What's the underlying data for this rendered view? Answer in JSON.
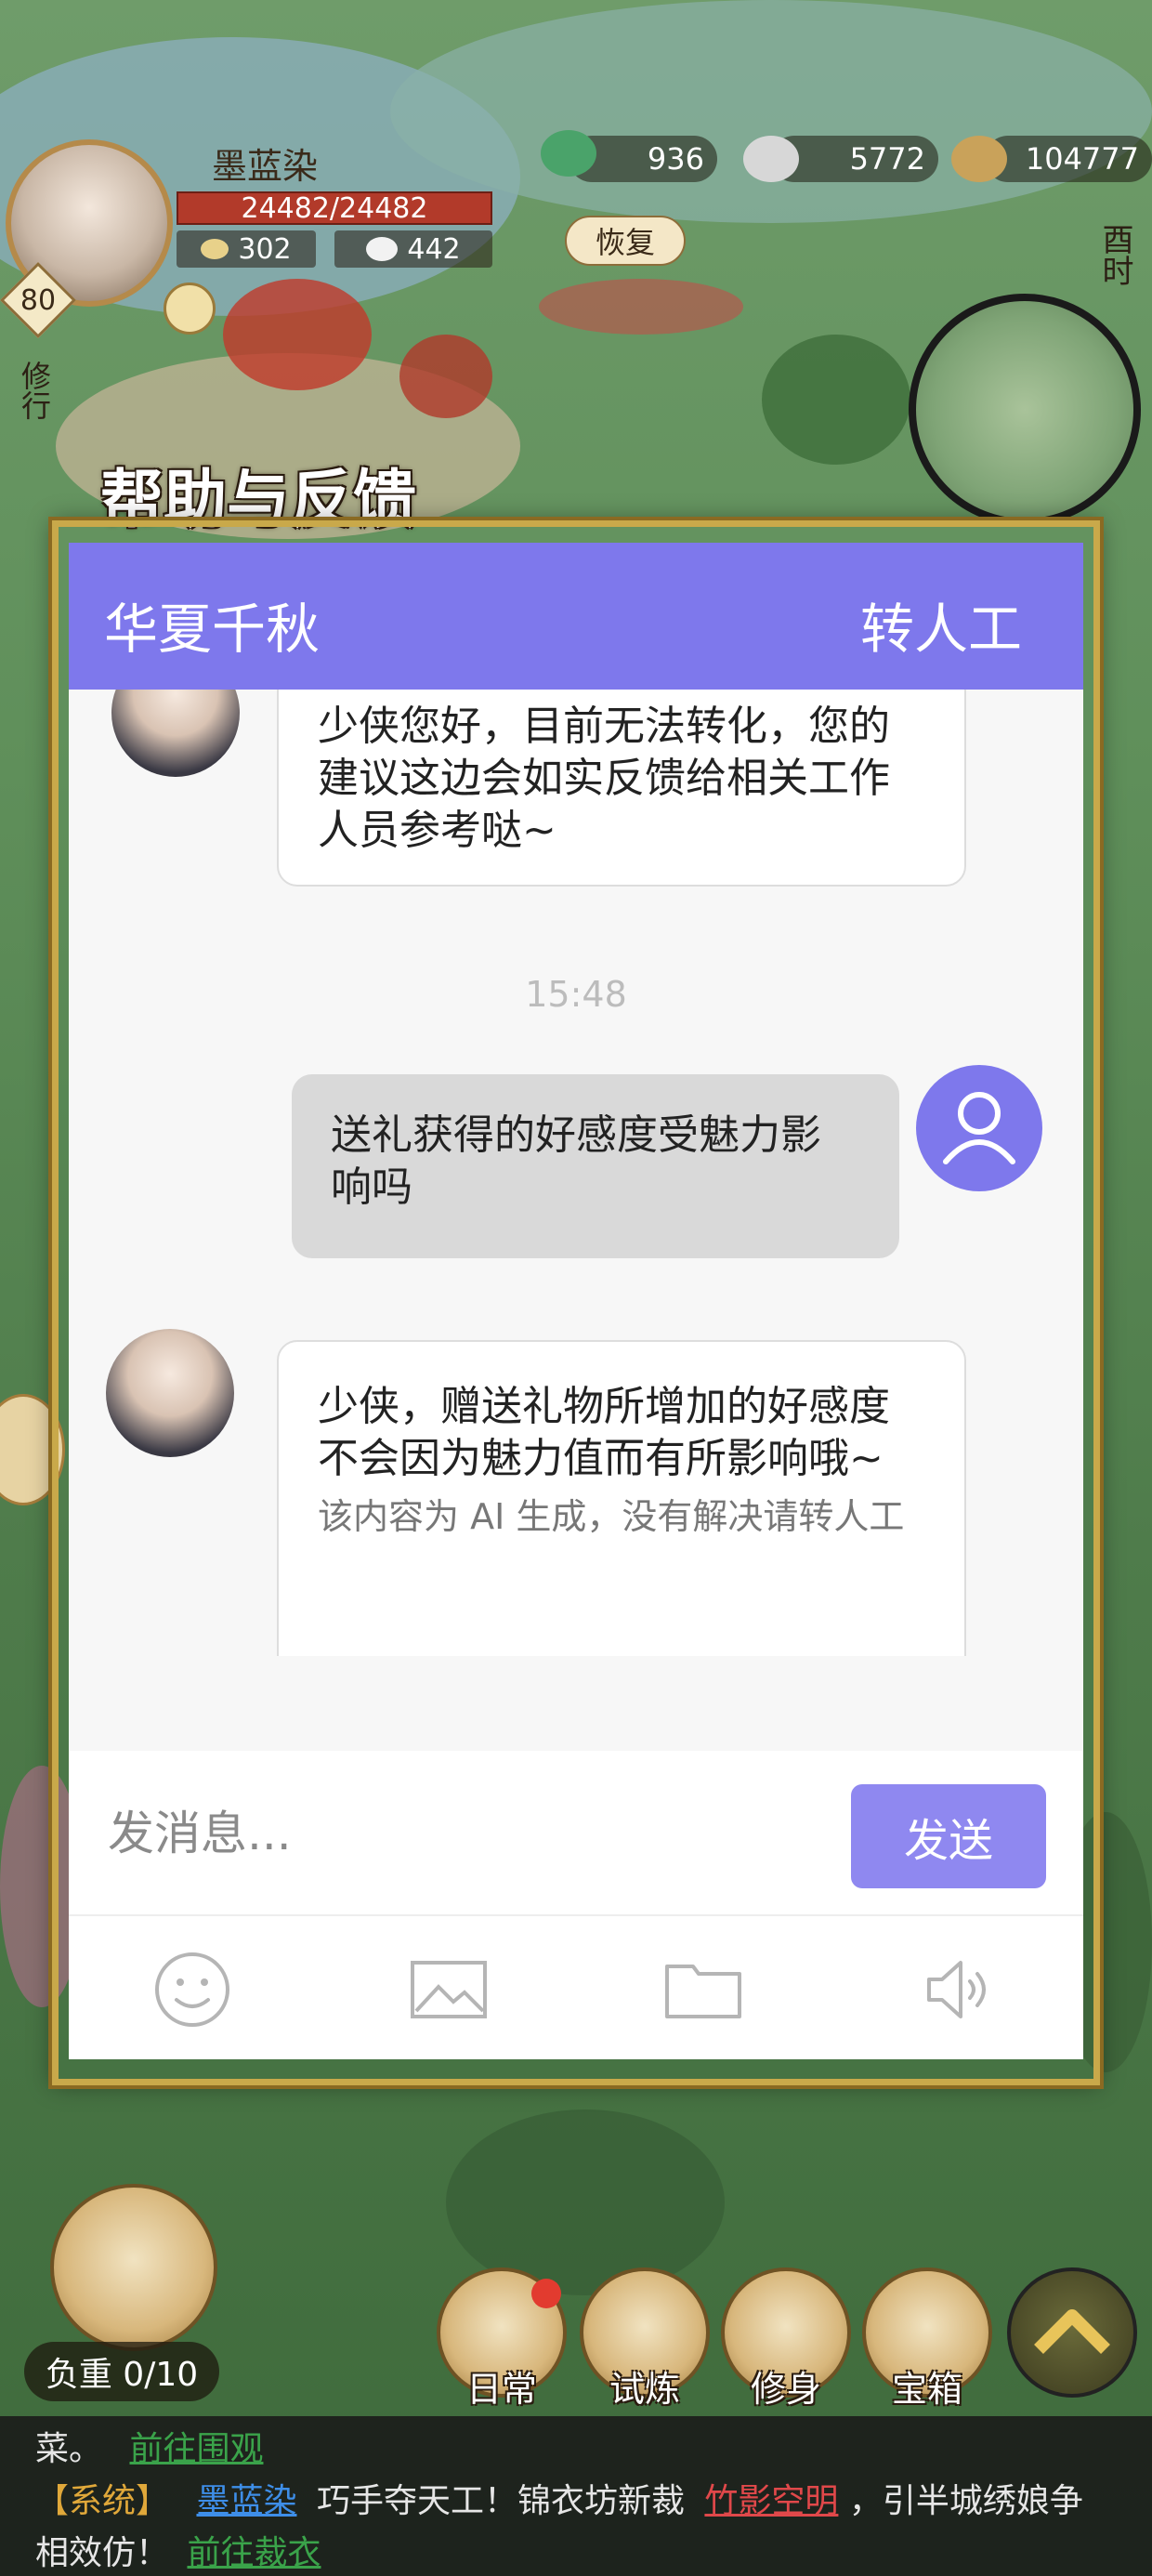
{
  "hud": {
    "player_name": "墨蓝染",
    "hp": "24482/24482",
    "stat_a": "302",
    "stat_b": "442",
    "level": "80",
    "res_jade": "936",
    "res_silver": "5772",
    "res_coin": "104777",
    "restore_label": "恢复",
    "time_label": "酉时",
    "cultivate_label": "修行"
  },
  "dialog": {
    "title": "帮助与反馈",
    "brand": "华夏千秋",
    "human_button": "转人工",
    "messages": [
      {
        "from": "bot",
        "text": "少侠您好，目前无法转化，您的建议这边会如实反馈给相关工作人员参考哒~"
      },
      {
        "from": "time",
        "text": "15:48"
      },
      {
        "from": "user",
        "text": "送礼获得的好感度受魅力影响吗"
      },
      {
        "from": "bot",
        "text": "少侠，赠送礼物所增加的好感度不会因为魅力值而有所影响哦~",
        "note": "该内容为 AI 生成，没有解决请转人工"
      }
    ],
    "input_placeholder": "发消息...",
    "send_label": "发送",
    "accent_color": "#7e78ec"
  },
  "bottom": {
    "load": "负重 0/10",
    "buttons": [
      "日常",
      "试炼",
      "修身",
      "宝箱"
    ]
  },
  "chat": {
    "line1_text": "菜。",
    "line1_link": "前往围观",
    "line2_tag": "【系统】",
    "line2_name": "墨蓝染",
    "line2_text": "巧手夺天工！锦衣坊新裁",
    "line2_item": "竹影空明",
    "line2_tail": "，引半城绣娘争",
    "line3_text": "相效仿！",
    "line3_link": "前往裁衣"
  }
}
